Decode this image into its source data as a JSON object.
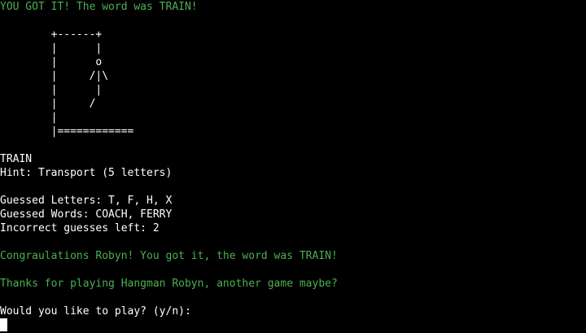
{
  "terminal": {
    "result_message": "YOU GOT IT! The word was TRAIN!",
    "gallows_art": "        +------+\n        |      |\n        |      o\n        |     /|\\\n        |      |\n        |     /\n        |\n        |============",
    "word": "TRAIN",
    "hint": "Hint: Transport (5 letters)",
    "guessed_letters": "Guessed Letters: T, F, H, X",
    "guessed_words": "Guessed Words: COACH, FERRY",
    "incorrect_left": "Incorrect guesses left: 2",
    "congrats": "Congraulations Robyn! You got it, the word was TRAIN!",
    "thanks": "Thanks for playing Hangman Robyn, another game maybe?",
    "prompt": "Would you like to play? (y/n): "
  },
  "colors": {
    "background": "#000000",
    "text": "#ffffff",
    "accent_green": "#4caf50"
  }
}
